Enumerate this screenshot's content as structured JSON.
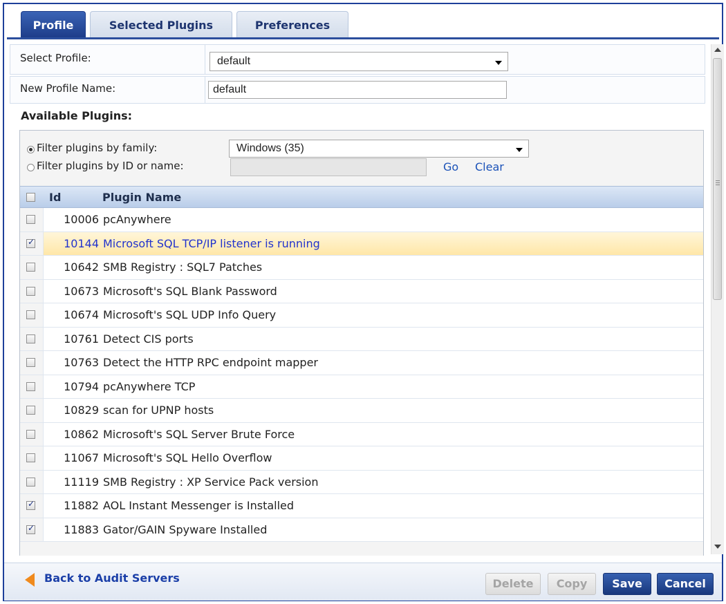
{
  "tabs": [
    {
      "label": "Profile",
      "active": true
    },
    {
      "label": "Selected Plugins",
      "active": false
    },
    {
      "label": "Preferences",
      "active": false
    }
  ],
  "profile": {
    "select_label": "Select Profile:",
    "select_value": "default",
    "name_label": "New Profile Name:",
    "name_value": "default"
  },
  "available": {
    "title": "Available Plugins:",
    "filter_family_label": "Filter plugins by family:",
    "filter_family_selected": true,
    "family_value": "Windows (35)",
    "filter_id_label": "Filter plugins by ID or name:",
    "filter_id_value": "",
    "go_label": "Go",
    "clear_label": "Clear"
  },
  "grid": {
    "columns": [
      "Id",
      "Plugin Name"
    ],
    "rows": [
      {
        "id": "10006",
        "name": "pcAnywhere",
        "checked": false,
        "selected": false
      },
      {
        "id": "10144",
        "name": "Microsoft SQL TCP/IP listener is running",
        "checked": true,
        "selected": true
      },
      {
        "id": "10642",
        "name": "SMB Registry : SQL7 Patches",
        "checked": false,
        "selected": false
      },
      {
        "id": "10673",
        "name": "Microsoft's SQL Blank Password",
        "checked": false,
        "selected": false
      },
      {
        "id": "10674",
        "name": "Microsoft's SQL UDP Info Query",
        "checked": false,
        "selected": false
      },
      {
        "id": "10761",
        "name": "Detect CIS ports",
        "checked": false,
        "selected": false
      },
      {
        "id": "10763",
        "name": "Detect the HTTP RPC endpoint mapper",
        "checked": false,
        "selected": false
      },
      {
        "id": "10794",
        "name": "pcAnywhere TCP",
        "checked": false,
        "selected": false
      },
      {
        "id": "10829",
        "name": "scan for UPNP hosts",
        "checked": false,
        "selected": false
      },
      {
        "id": "10862",
        "name": "Microsoft's SQL Server Brute Force",
        "checked": false,
        "selected": false
      },
      {
        "id": "11067",
        "name": "Microsoft's SQL Hello Overflow",
        "checked": false,
        "selected": false
      },
      {
        "id": "11119",
        "name": "SMB Registry : XP Service Pack version",
        "checked": false,
        "selected": false
      },
      {
        "id": "11882",
        "name": "AOL Instant Messenger is Installed",
        "checked": true,
        "selected": false
      },
      {
        "id": "11883",
        "name": "Gator/GAIN Spyware Installed",
        "checked": true,
        "selected": false
      }
    ]
  },
  "footer": {
    "back_label": "Back to Audit Servers",
    "delete_label": "Delete",
    "copy_label": "Copy",
    "save_label": "Save",
    "cancel_label": "Cancel"
  },
  "colors": {
    "accent": "#1e3d8a",
    "link": "#1b52b8",
    "back_arrow": "#f08a1d",
    "row_highlight": "#ffe7a8"
  }
}
